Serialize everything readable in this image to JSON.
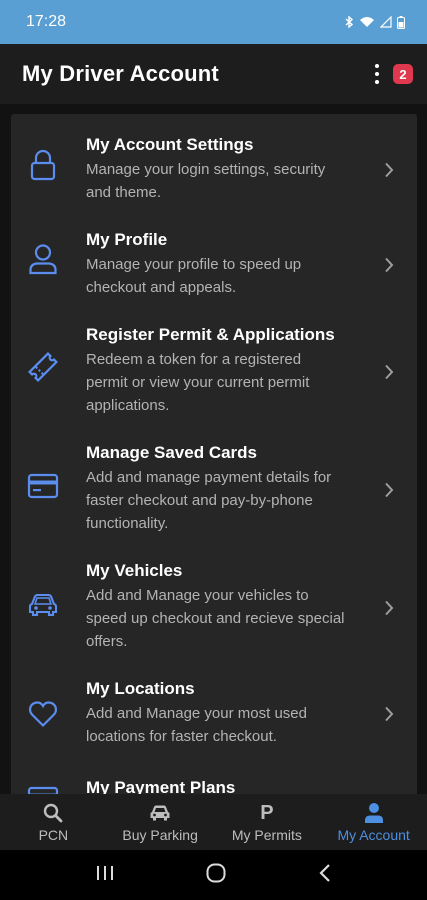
{
  "status_bar": {
    "time": "17:28",
    "icons": [
      "bluetooth-icon",
      "wifi-icon",
      "signal-icon",
      "battery-icon"
    ]
  },
  "header": {
    "title": "My Driver Account",
    "notification_count": "2",
    "menu_icon": "more-vert-icon"
  },
  "menu": {
    "items": [
      {
        "icon": "lock-icon",
        "title": "My Account Settings",
        "desc": [
          "Manage your login settings, security",
          "and theme."
        ]
      },
      {
        "icon": "person-icon",
        "title": "My Profile",
        "desc": [
          "Manage your profile to speed up",
          "checkout and appeals."
        ]
      },
      {
        "icon": "ticket-icon",
        "title": "Register Permit & Applications",
        "desc": [
          "Redeem a token for a registered",
          "permit or view your current permit",
          "applications."
        ]
      },
      {
        "icon": "credit-card-icon",
        "title": "Manage Saved Cards",
        "desc": [
          "Add and manage payment details for",
          "faster checkout and pay-by-phone",
          "functionality."
        ]
      },
      {
        "icon": "car-icon",
        "title": "My Vehicles",
        "desc": [
          "Add and Manage your vehicles to",
          "speed up checkout and recieve special",
          "offers."
        ]
      },
      {
        "icon": "heart-icon",
        "title": "My Locations",
        "desc": [
          "Add and Manage your most used",
          "locations for faster checkout."
        ]
      },
      {
        "icon": "payment-plan-icon",
        "title": "My Payment Plans",
        "desc": []
      }
    ]
  },
  "bottom_nav": {
    "items": [
      {
        "label": "PCN",
        "icon": "search-icon"
      },
      {
        "label": "Buy Parking",
        "icon": "car-icon"
      },
      {
        "label": "My Permits",
        "icon": "p-icon",
        "glyph": "P"
      },
      {
        "label": "My Account",
        "icon": "person-icon",
        "active": true
      }
    ]
  },
  "colors": {
    "status_bar": "#5a9fd3",
    "header": "#1d1d1d",
    "card": "#262626",
    "icon_accent": "#5b8def",
    "active_nav": "#4d8fe0",
    "badge": "#e0384e"
  }
}
